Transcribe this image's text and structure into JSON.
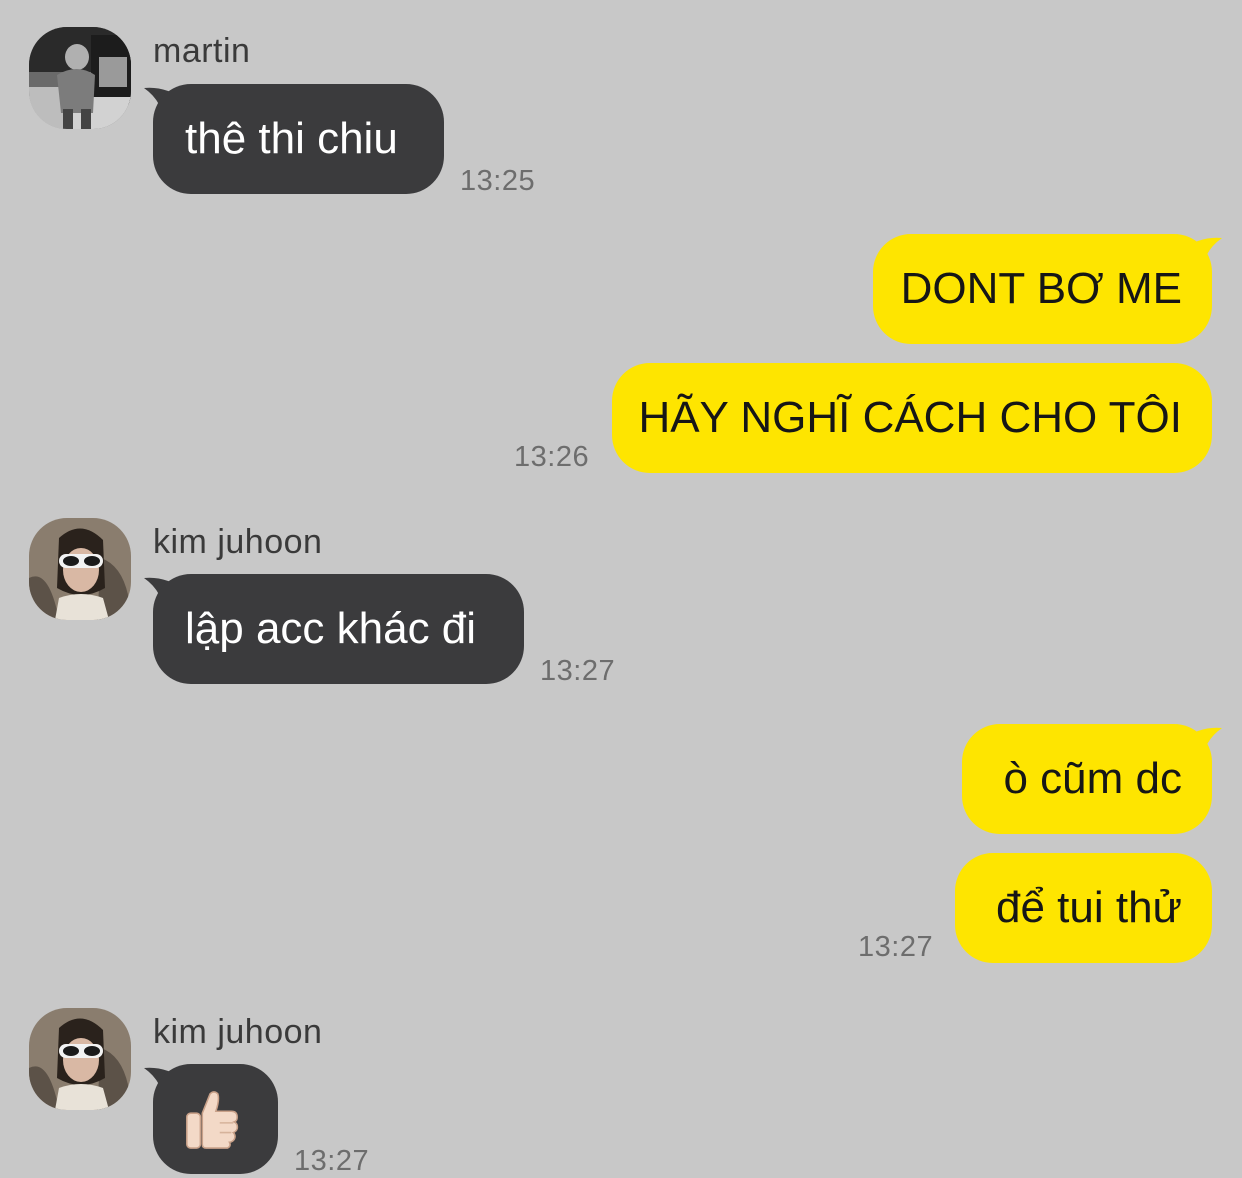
{
  "colors": {
    "background": "#c8c8c8",
    "incoming_bubble": "#3b3b3d",
    "outgoing_bubble": "#fee500",
    "incoming_text": "#ffffff",
    "outgoing_text": "#161616",
    "timestamp": "#6d6d6d"
  },
  "messages": {
    "m1": {
      "sender": "martin",
      "text": "thê thi chiu",
      "time": "13:25"
    },
    "m2": {
      "text": "DONT BƠ ME"
    },
    "m3": {
      "text": "HÃY NGHĨ CÁCH CHO TÔI",
      "time": "13:26"
    },
    "m4": {
      "sender": "kim juhoon",
      "text": "lập acc khác đi",
      "time": "13:27"
    },
    "m5": {
      "text": "ò cũm dc"
    },
    "m6": {
      "text": "để tui thử",
      "time": "13:27"
    },
    "m7": {
      "sender": "kim juhoon",
      "emoji": "thumbs-up-emoji",
      "time": "13:27"
    }
  }
}
